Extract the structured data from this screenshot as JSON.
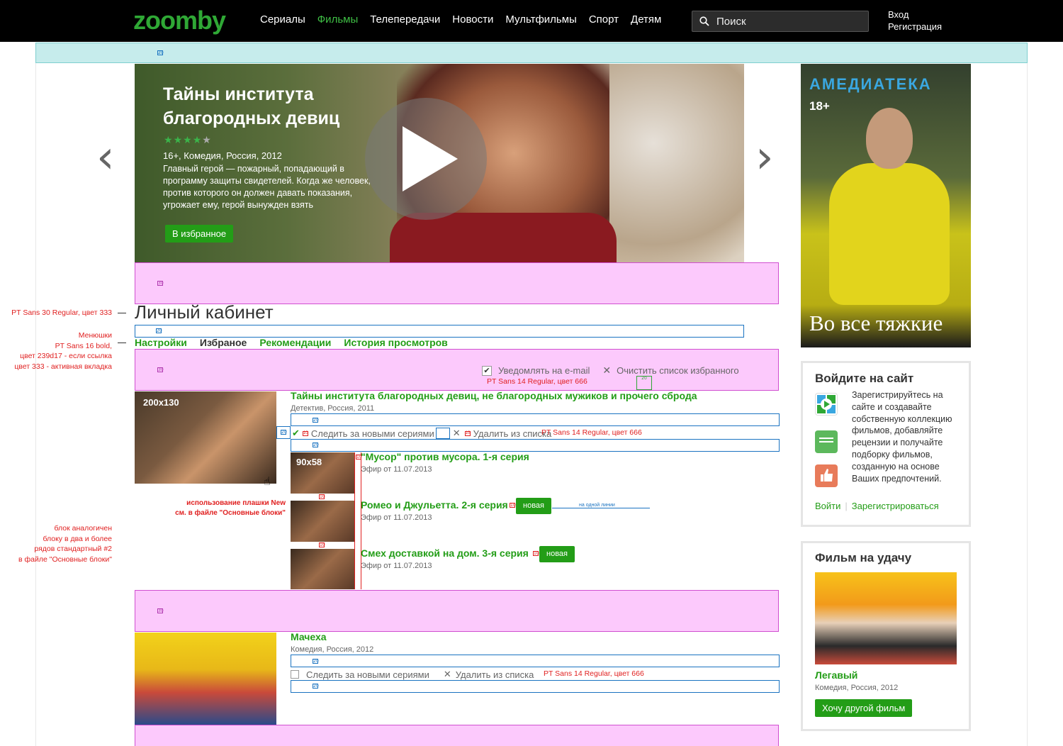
{
  "header": {
    "logo": "zoomby",
    "nav": [
      {
        "label": "Сериалы",
        "active": false
      },
      {
        "label": "Фильмы",
        "active": true
      },
      {
        "label": "Телепередачи",
        "active": false
      },
      {
        "label": "Новости",
        "active": false
      },
      {
        "label": "Мультфильмы",
        "active": false
      },
      {
        "label": "Спорт",
        "active": false
      },
      {
        "label": "Детям",
        "active": false
      }
    ],
    "search_placeholder": "Поиск",
    "login": "Вход",
    "register": "Регистрация"
  },
  "hero": {
    "title": "Тайны института благородных девиц",
    "rating": 4,
    "rating_max": 5,
    "meta": "16+, Комедия, Россия, 2012",
    "description": "Главный герой — пожарный, попадающий в программу защиты свидетелей. Когда же человек, против которого он должен давать показания, угрожает ему, герой вынужден взять",
    "button": "В избранное"
  },
  "poster": {
    "brand": "АМЕДИАТЕКА",
    "age": "18+",
    "slogan": "Во все тяжкие"
  },
  "cabinet": {
    "title": "Личный кабинет",
    "tabs": [
      {
        "label": "Настройки",
        "active": false
      },
      {
        "label": "Избраное",
        "active": true
      },
      {
        "label": "Рекомендации",
        "active": false
      },
      {
        "label": "История просмотров",
        "active": false
      }
    ],
    "notify_label": "Уведомлять на e-mail",
    "clear_label": "Очистить список избранного"
  },
  "annotations": {
    "title_font": "PT Sans 30 Regular, цвет 333",
    "tabs_font": [
      "Менюшки",
      "PT Sans 16 bold,",
      "цвет 239d17 - если ссылка",
      "цвет 333 - активная вкладка"
    ],
    "notify_font": "PT Sans 14 Regular,  цвет 666",
    "actions_font": "PT Sans 14 Regular,  цвет 666",
    "badge_note": [
      "использование плашки New",
      "см. в файле \"Основные блоки\""
    ],
    "block_note": [
      "блок аналогичен",
      "блоку в два и более",
      "рядов стандартный #2",
      "в файле \"Основные блоки\""
    ],
    "one_line": "на одной линии"
  },
  "favorites": [
    {
      "thumb_label": "200x130",
      "title": "Тайны института благородных девиц, не благородных мужиков и прочего сброда",
      "meta": "Детектив, Россия, 2011",
      "follow": "Следить за новыми сериями",
      "remove": "Удалить из списка",
      "episodes": [
        {
          "thumb_label": "90x58",
          "title": "\"Мусор\" против мусора. 1-я серия",
          "meta": "Эфир от 11.07.2013",
          "new": false
        },
        {
          "thumb_label": "",
          "title": "Ромео и Джульетта. 2-я серия",
          "meta": "Эфир от 11.07.2013",
          "new": true
        },
        {
          "thumb_label": "",
          "title": "Смех  доставкой на дом. 3-я серия",
          "meta": "Эфир от 11.07.2013",
          "new": true
        }
      ]
    },
    {
      "thumb_label": "",
      "title": "Мачеха",
      "meta": "Комедия, Россия, 2012",
      "follow": "Следить за новыми сериями",
      "remove": "Удалить из списка"
    }
  ],
  "new_badge": "новая",
  "login_widget": {
    "title": "Войдите на сайт",
    "text": "Зарегистрируйтесь на сайте и создавайте собственную коллекцию фильмов, добавляйте рецензии и получайте подборку фильмов, созданную на основе Ваших предпочтений.",
    "login": "Войти",
    "register": "Зарегистрироваться"
  },
  "random_widget": {
    "title": "Фильм на удачу",
    "movie": "Легавый",
    "meta": "Комедия, Россия, 2012",
    "button": "Хочу другой фильм"
  }
}
